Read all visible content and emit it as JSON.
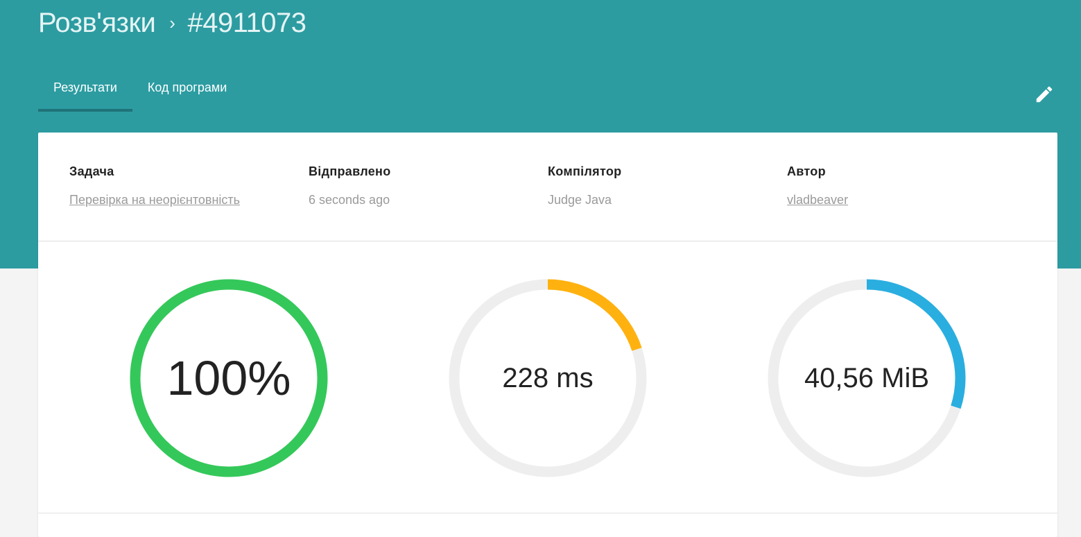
{
  "breadcrumb": {
    "parent": "Розв'язки",
    "separator": "›",
    "current": "#4911073"
  },
  "tabs": [
    {
      "label": "Результати",
      "active": true
    },
    {
      "label": "Код програми",
      "active": false
    }
  ],
  "edit_icon": "pencil-icon",
  "info": {
    "task": {
      "label": "Задача",
      "value": "Перевірка на неорієнтовність"
    },
    "sent": {
      "label": "Відправлено",
      "value": "6 seconds ago"
    },
    "compiler": {
      "label": "Компілятор",
      "value": "Judge Java"
    },
    "author": {
      "label": "Автор",
      "value": "vladbeaver"
    }
  },
  "gauges": {
    "score": {
      "text": "100%",
      "fraction": 1.0,
      "color": "#34c85a"
    },
    "time": {
      "text": "228 ms",
      "fraction": 0.2,
      "color": "#ffb20f"
    },
    "memory": {
      "text": "40,56 MiB",
      "fraction": 0.3,
      "color": "#2aaee0"
    }
  },
  "colors": {
    "header": "#2c9ca1",
    "track": "#eeeeee"
  }
}
